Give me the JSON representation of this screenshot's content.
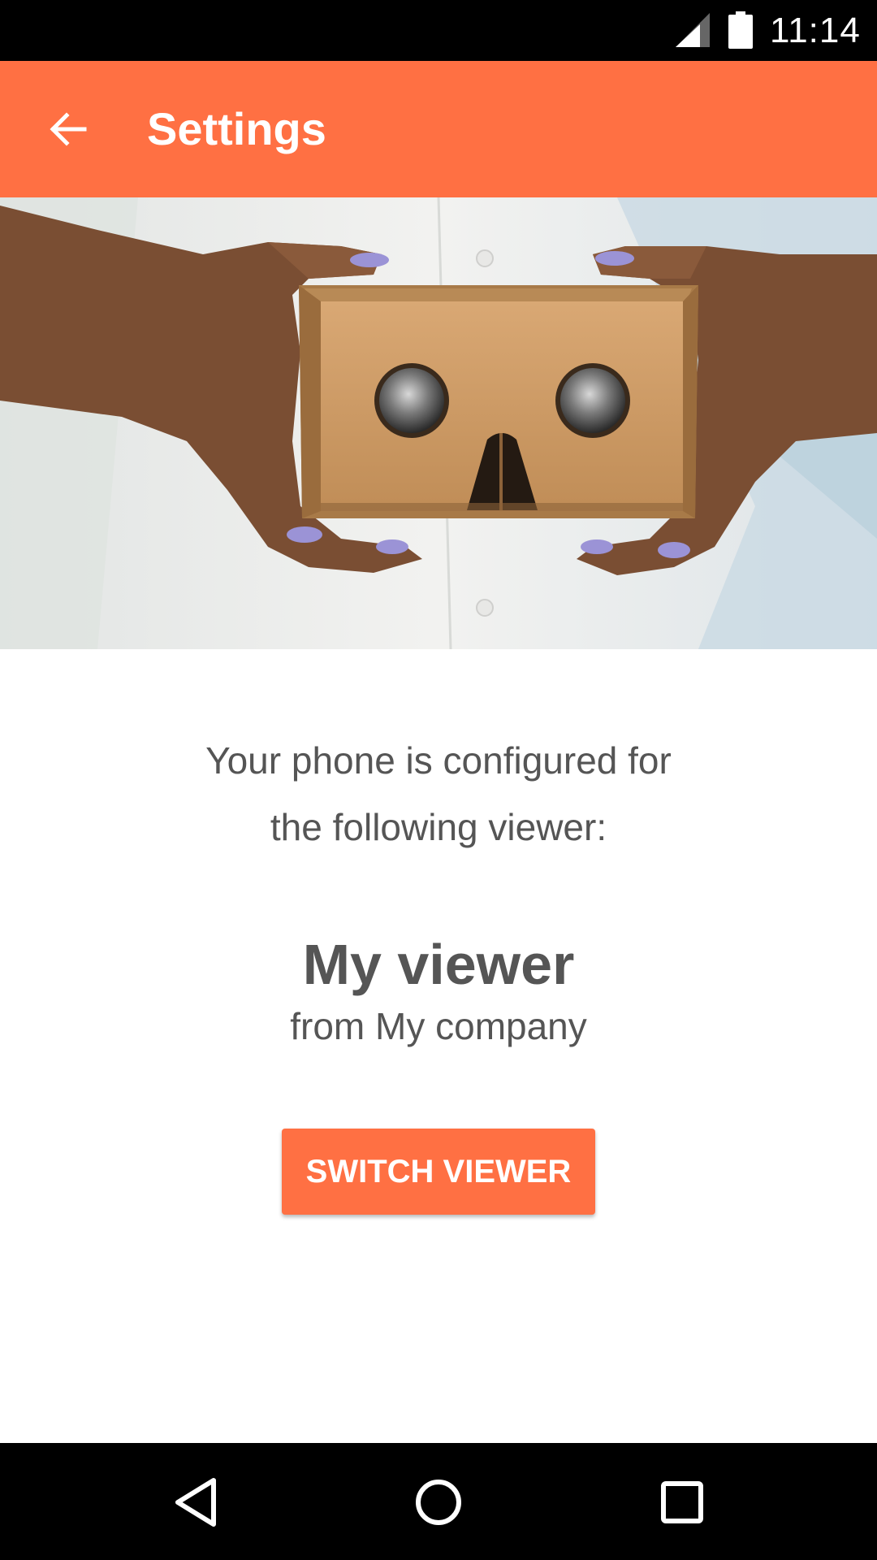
{
  "status_bar": {
    "time": "11:14",
    "icons": [
      "cellular-signal-icon",
      "battery-icon"
    ]
  },
  "app_bar": {
    "title": "Settings",
    "back_icon": "arrow-back-icon",
    "background_color": "#ff7043"
  },
  "hero": {
    "image_description_icon": "cardboard-viewer-photo"
  },
  "content": {
    "configured_line_1": "Your phone is configured for",
    "configured_line_2": "the following viewer:",
    "viewer_name": "My viewer",
    "viewer_company": "from My company",
    "switch_button_label": "SWITCH VIEWER"
  },
  "nav_bar": {
    "icons": [
      "back-triangle-icon",
      "home-circle-icon",
      "recents-square-icon"
    ]
  },
  "colors": {
    "accent": "#ff7043",
    "text": "#555555",
    "system_bars": "#000000"
  }
}
